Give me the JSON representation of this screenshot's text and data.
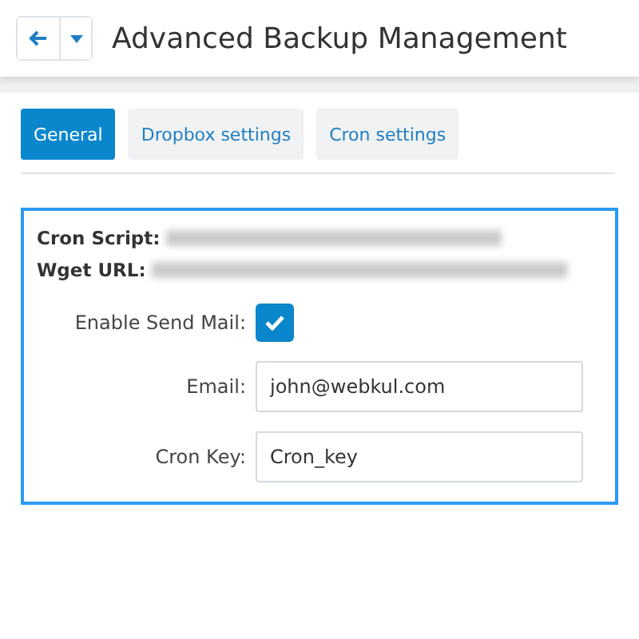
{
  "header": {
    "title": "Advanced Backup Management"
  },
  "tabs": [
    {
      "label": "General",
      "selected": true
    },
    {
      "label": "Dropbox settings",
      "selected": false
    },
    {
      "label": "Cron settings",
      "selected": false
    }
  ],
  "info": [
    {
      "label": "Cron Script:"
    },
    {
      "label": "Wget URL:"
    }
  ],
  "fields": [
    {
      "kind": "checkbox",
      "label": "Enable Send Mail:",
      "checked": true
    },
    {
      "kind": "text",
      "label": "Email:",
      "value": "john@webkul.com"
    },
    {
      "kind": "text",
      "label": "Cron Key:",
      "value": "Cron_key"
    }
  ]
}
